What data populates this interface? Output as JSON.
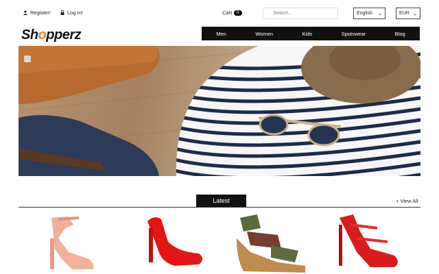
{
  "account": {
    "register": "Register!",
    "login": "Log In!"
  },
  "cart": {
    "label": "Cart",
    "count": "0"
  },
  "search": {
    "placeholder": "Search..."
  },
  "language": {
    "selected": "English"
  },
  "currency": {
    "selected": "EUR"
  },
  "logo": {
    "part1": "Sh",
    "o": "o",
    "part2": "pperz"
  },
  "nav": [
    {
      "label": "Men"
    },
    {
      "label": "Women"
    },
    {
      "label": "Kids"
    },
    {
      "label": "Spotswear"
    },
    {
      "label": "Blog"
    }
  ],
  "latest": {
    "title": "Latest",
    "view_all": "+ View All"
  },
  "colors": {
    "accent": "#f47a1f",
    "nav_bg": "#111111"
  }
}
